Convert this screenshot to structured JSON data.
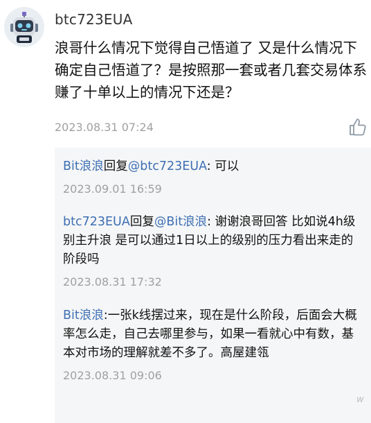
{
  "comment": {
    "username": "btc723EUA",
    "text": "浪哥什么情况下觉得自己悟道了 又是什么情况下确定自己悟道了？是按照那一套或者几套交易体系赚了十单以上的情况下还是？",
    "time": "2023.08.31 07:24"
  },
  "replies": [
    {
      "author": "Bit浪浪",
      "connector": "回复",
      "target": "@btc723EUA",
      "text": ": 可以",
      "time": "2023.09.01 16:59"
    },
    {
      "author": "btc723EUA",
      "connector": "回复",
      "target": "@Bit浪浪",
      "text": ": 谢谢浪哥回答 比如说4h级别主升浪 是可以通过1日以上的级别的压力看出来走的阶段吗",
      "time": "2023.08.31 17:32"
    },
    {
      "author": "Bit浪浪",
      "text": ":一张k线摆过来，现在是什么阶段，后面会大概率怎么走，自己去哪里参与，如果一看就心中有数，基本对市场的理解就差不多了。高屋建瓴",
      "time": "2023.08.31 09:06"
    }
  ],
  "watermark": "w",
  "icons": {
    "avatar": "robot-avatar-icon",
    "like": "thumbs-up-icon"
  },
  "colors": {
    "link": "#3d6fb3",
    "meta": "#a0a0a0",
    "reply_bg": "#f5f6f7"
  }
}
